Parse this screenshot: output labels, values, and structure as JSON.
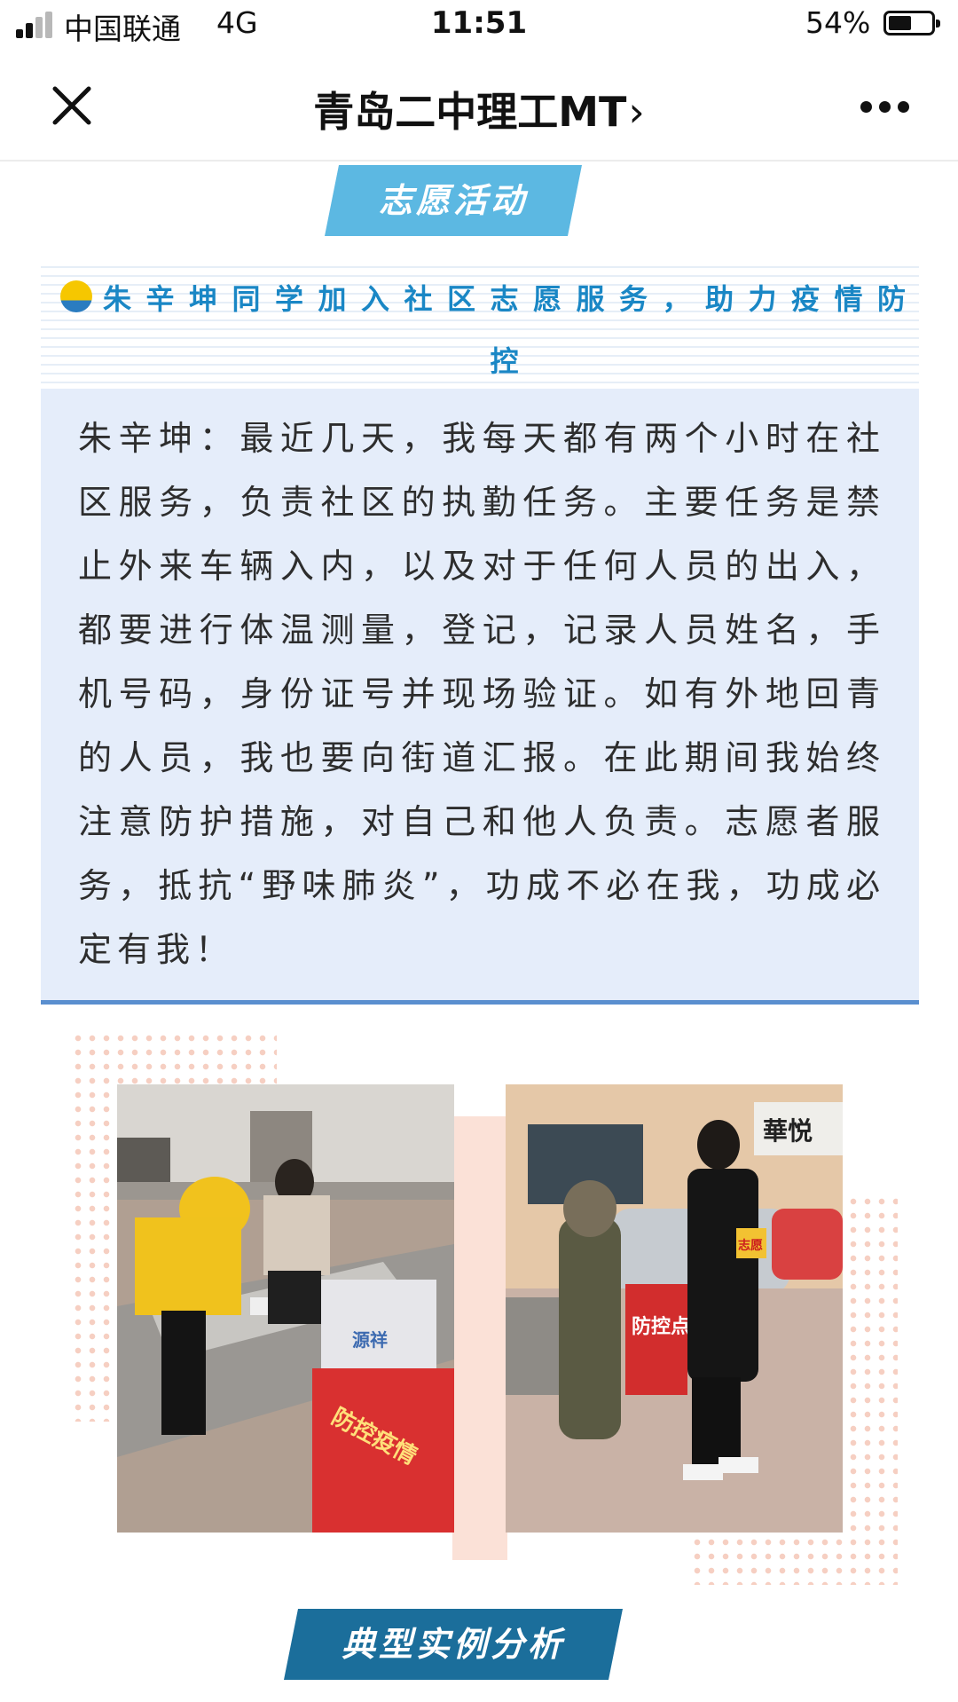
{
  "status_bar": {
    "carrier": "中国联通",
    "network": "4G",
    "time": "11:51",
    "battery_percent": "54%",
    "battery_level": 0.54
  },
  "nav": {
    "title": "青岛二中理工MT",
    "chevron": "›",
    "close_icon": "close-icon",
    "more_icon": "more-icon"
  },
  "section_banner_1": "志愿活动",
  "headline": "朱辛坤同学加入社区志愿服务，助力疫情防控",
  "article": {
    "body": "朱辛坤：最近几天，我每天都有两个小时在社区服务，负责社区的执勤任务。主要任务是禁止外来车辆入内，以及对于任何人员的出入，都要进行体温测量，登记，记录人员姓名，手机号码，身份证号并现场验证。如有外地回青的人员，我也要向街道汇报。在此期间我始终注意防护措施，对自己和他人负责。志愿者服务，抵抗“野味肺炎”，功成不必在我，功成必定有我！"
  },
  "photos": {
    "photo1_sign": "防控疫情",
    "photo1_bag": "源祥",
    "photo2_sign": "防控点",
    "photo2_shop": "華悦",
    "photo2_armband": "志愿"
  },
  "section_banner_2": "典型实例分析",
  "colors": {
    "banner_light": "#5cb8e2",
    "banner_dark": "#1b6e9b",
    "headline": "#1a87c5",
    "card_bg": "#e5edfa",
    "card_border": "#5a8fcf"
  }
}
